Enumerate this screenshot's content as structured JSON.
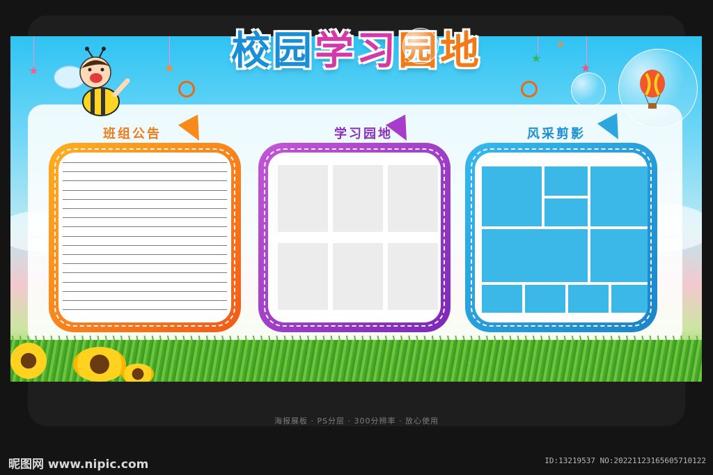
{
  "poster": {
    "title_part1": "校园",
    "title_part2": "学习",
    "title_part3": "园地",
    "panels": [
      {
        "label": "班组公告",
        "color": "#f07b18"
      },
      {
        "label": "学习园地",
        "color": "#8a2fc0"
      },
      {
        "label": "风采剪影",
        "color": "#1a8fd6"
      }
    ]
  },
  "footer": {
    "caption": "海报展板 · PS分层 · 300分辨率 · 放心使用",
    "site_logo": "昵图网 www.nipic.com",
    "id_text": "ID:13219537 NO:20221123165605710122"
  },
  "icons": [
    "bee-cartoon-icon",
    "star-icon",
    "bubble-icon",
    "hot-air-balloon-icon",
    "sunflower-icon"
  ]
}
